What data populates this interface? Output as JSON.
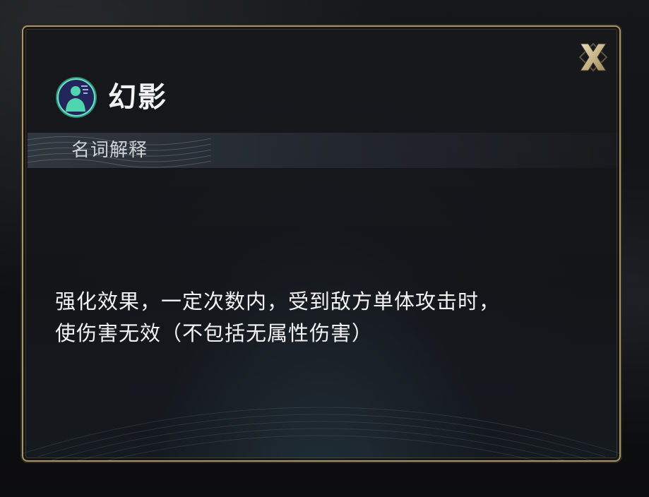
{
  "dialog": {
    "title": "幻影",
    "title_icon": "character-silhouette-icon",
    "section_label": "名词解释",
    "description_lines": [
      "强化效果，一定次数内，受到敌方单体攻击时，",
      "使伤害无效（不包括无属性伤害）"
    ],
    "close_icon": "close-x-icon"
  },
  "colors": {
    "frame_gold": "#a7946a",
    "panel_bg": "#16171b",
    "title_text": "#f2f2f2",
    "icon_teal": "#3bb89a",
    "section_bar": "#48525e"
  }
}
